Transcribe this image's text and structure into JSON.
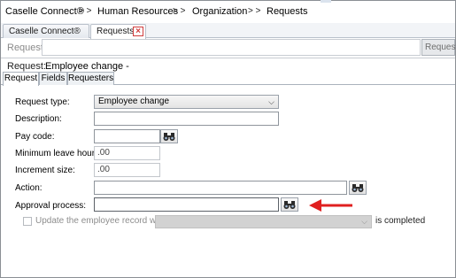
{
  "breadcrumb": {
    "items": [
      "Caselle Connect®",
      "Human Resources",
      "Organization",
      "Requests"
    ],
    "separator": "> >"
  },
  "window_tabs": [
    {
      "label": "Caselle Connect®",
      "active": false
    },
    {
      "label": "Requests",
      "active": true
    }
  ],
  "search": {
    "label": "Request:",
    "value": "",
    "button_label": "Request"
  },
  "record": {
    "label": "Request:",
    "value": "Employee change -"
  },
  "inner_tabs": [
    {
      "label": "Request",
      "active": true
    },
    {
      "label": "Fields",
      "active": false
    },
    {
      "label": "Requesters",
      "active": false
    }
  ],
  "form": {
    "request_type": {
      "label": "Request type:",
      "value": "Employee change"
    },
    "description": {
      "label": "Description:",
      "value": ""
    },
    "pay_code": {
      "label": "Pay code:",
      "value": ""
    },
    "min_leave_hours": {
      "label": "Minimum leave hours:",
      "value": ".00"
    },
    "increment_size": {
      "label": "Increment size:",
      "value": ".00"
    },
    "action": {
      "label": "Action:",
      "value": ""
    },
    "approval_process": {
      "label": "Approval process:",
      "value": ""
    },
    "update_record": {
      "label": "Update the employee record when",
      "suffix": "is completed",
      "checked": false,
      "enabled": false
    }
  },
  "icons": {
    "lookup": "binoculars-icon",
    "tab_close": "close-icon",
    "dropdown": "chevron-down-icon",
    "annotation": "red-arrow-icon"
  },
  "colors": {
    "annotation_arrow": "#e02020",
    "tab_close": "#d03c3c",
    "disabled_field": "#d2d2d2"
  }
}
